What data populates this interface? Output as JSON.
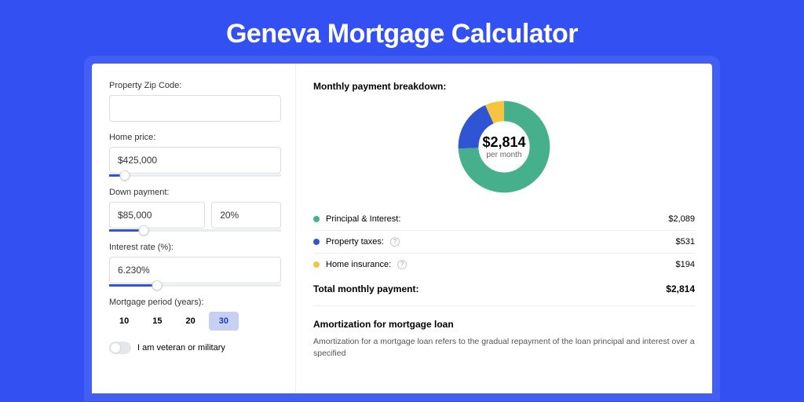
{
  "title": "Geneva Mortgage Calculator",
  "form": {
    "zip_label": "Property Zip Code:",
    "zip_value": "",
    "price_label": "Home price:",
    "price_value": "$425,000",
    "price_slider_pct": 9,
    "down_label": "Down payment:",
    "down_value": "$85,000",
    "down_pct_value": "20%",
    "down_slider_pct": 20,
    "rate_label": "Interest rate (%):",
    "rate_value": "6.230%",
    "rate_slider_pct": 28,
    "period_label": "Mortgage period (years):",
    "periods": [
      "10",
      "15",
      "20",
      "30"
    ],
    "period_selected": "30",
    "veteran_label": "I am veteran or military",
    "veteran_on": false
  },
  "breakdown": {
    "title": "Monthly payment breakdown:",
    "center_amount": "$2,814",
    "center_sub": "per month",
    "items": [
      {
        "label": "Principal & Interest:",
        "value": "$2,089",
        "color": "#46b08c",
        "help": false
      },
      {
        "label": "Property taxes:",
        "value": "$531",
        "color": "#2f55d4",
        "help": true
      },
      {
        "label": "Home insurance:",
        "value": "$194",
        "color": "#f5c542",
        "help": true
      }
    ],
    "total_label": "Total monthly payment:",
    "total_value": "$2,814"
  },
  "chart_data": {
    "type": "pie",
    "title": "Monthly payment breakdown",
    "series": [
      {
        "name": "Principal & Interest",
        "value": 2089,
        "color": "#46b08c"
      },
      {
        "name": "Property taxes",
        "value": 531,
        "color": "#2f55d4"
      },
      {
        "name": "Home insurance",
        "value": 194,
        "color": "#f5c542"
      }
    ],
    "total": 2814,
    "center_label": "$2,814 per month"
  },
  "amortization": {
    "title": "Amortization for mortgage loan",
    "text": "Amortization for a mortgage loan refers to the gradual repayment of the loan principal and interest over a specified"
  }
}
